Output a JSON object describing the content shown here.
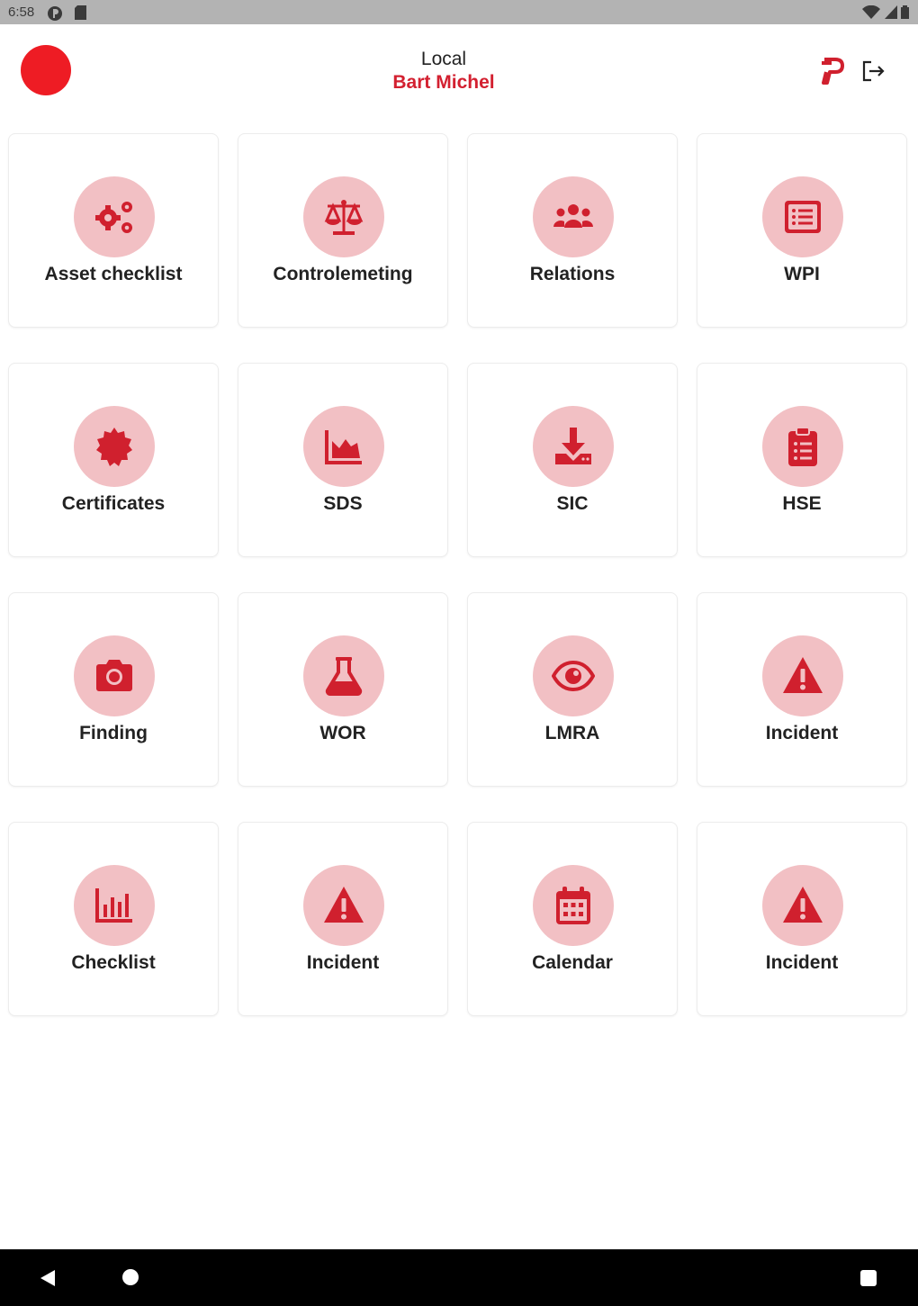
{
  "status_bar": {
    "time": "6:58",
    "icons_left": [
      "app-notification-icon",
      "sd-card-icon"
    ],
    "icons_right": [
      "wifi-icon",
      "cell-signal-icon",
      "battery-icon"
    ]
  },
  "header": {
    "subtitle": "Local",
    "user_name": "Bart Michel",
    "accent_color": "#d32030",
    "avatar_color": "#ee1c24"
  },
  "tiles": [
    {
      "label": "Asset checklist",
      "icon": "cogs-icon"
    },
    {
      "label": "Controlemeting",
      "icon": "balance-scale-icon"
    },
    {
      "label": "Relations",
      "icon": "users-icon"
    },
    {
      "label": "WPI",
      "icon": "list-alt-icon"
    },
    {
      "label": "Certificates",
      "icon": "certificate-icon"
    },
    {
      "label": "SDS",
      "icon": "area-chart-icon"
    },
    {
      "label": "SIC",
      "icon": "download-icon"
    },
    {
      "label": "HSE",
      "icon": "clipboard-list-icon"
    },
    {
      "label": "Finding",
      "icon": "camera-icon"
    },
    {
      "label": "WOR",
      "icon": "flask-icon"
    },
    {
      "label": "LMRA",
      "icon": "eye-icon"
    },
    {
      "label": "Incident",
      "icon": "warning-icon"
    },
    {
      "label": "Checklist",
      "icon": "bar-chart-icon"
    },
    {
      "label": "Incident",
      "icon": "warning-icon"
    },
    {
      "label": "Calendar",
      "icon": "calendar-icon"
    },
    {
      "label": "Incident",
      "icon": "warning-icon"
    }
  ],
  "colors": {
    "icon_red": "#d0202e",
    "circle_pink": "#f2c0c4"
  }
}
